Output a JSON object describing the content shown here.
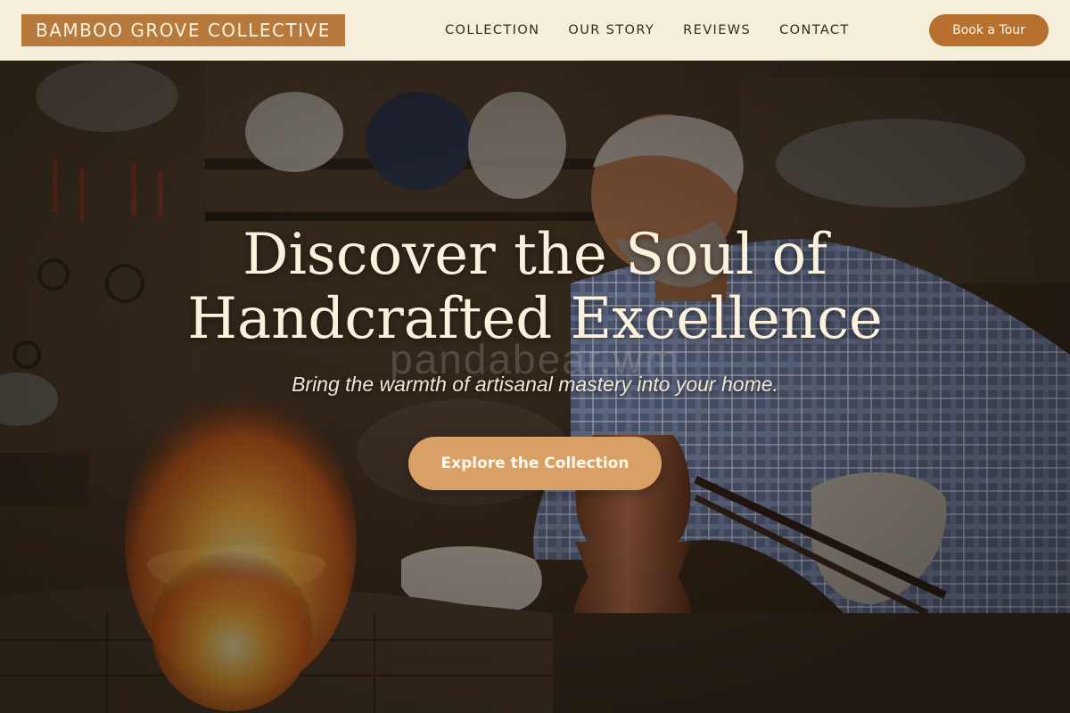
{
  "brand": {
    "name": "BAMBOO GROVE COLLECTIVE"
  },
  "nav": {
    "items": [
      "COLLECTION",
      "OUR STORY",
      "REVIEWS",
      "CONTACT"
    ],
    "cta_label": "Book a Tour"
  },
  "hero": {
    "title_line1": "Discover the Soul of",
    "title_line2": "Handcrafted Excellence",
    "subtitle": "Bring the warmth of artisanal mastery into your home.",
    "cta_label": "Explore the Collection",
    "watermark": "pandabear.wm"
  },
  "colors": {
    "header_bg": "#f5eedb",
    "accent": "#b87a3c",
    "button": "#b8702f",
    "cta": "#d9a066"
  }
}
